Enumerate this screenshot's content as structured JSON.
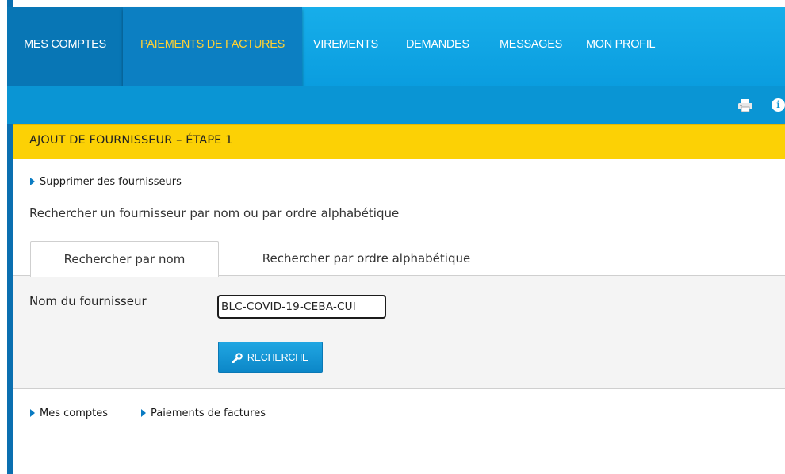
{
  "nav": {
    "items": [
      {
        "label": "MES COMPTES"
      },
      {
        "label": "PAIEMENTS DE FACTURES",
        "active": true
      },
      {
        "label": "VIREMENTS"
      },
      {
        "label": "DEMANDES"
      },
      {
        "label": "MESSAGES"
      },
      {
        "label": "MON PROFIL"
      }
    ]
  },
  "toolbar": {
    "icons": [
      "print-icon",
      "info-icon"
    ],
    "info_glyph": "i"
  },
  "step": {
    "title": "AJOUT DE FOURNISSEUR – ÉTAPE 1"
  },
  "links": {
    "delete_suppliers": "Supprimer des fournisseurs"
  },
  "instructions": "Rechercher un fournisseur par nom ou par ordre alphabétique",
  "tabs": [
    {
      "label": "Rechercher par nom",
      "active": true
    },
    {
      "label": "Rechercher par ordre alphabétique"
    }
  ],
  "search": {
    "field_label": "Nom du fournisseur",
    "field_value": "BLC-COVID-19-CEBA-CUI",
    "button_label": "RECHERCHE"
  },
  "breadcrumb": [
    {
      "label": "Mes comptes"
    },
    {
      "label": "Paiements de factures"
    }
  ],
  "colors": {
    "nav_blue": "#0a9ddf",
    "active_text": "#ffd133",
    "step_yellow": "#fcd105",
    "chevron": "#0a7bc2"
  }
}
